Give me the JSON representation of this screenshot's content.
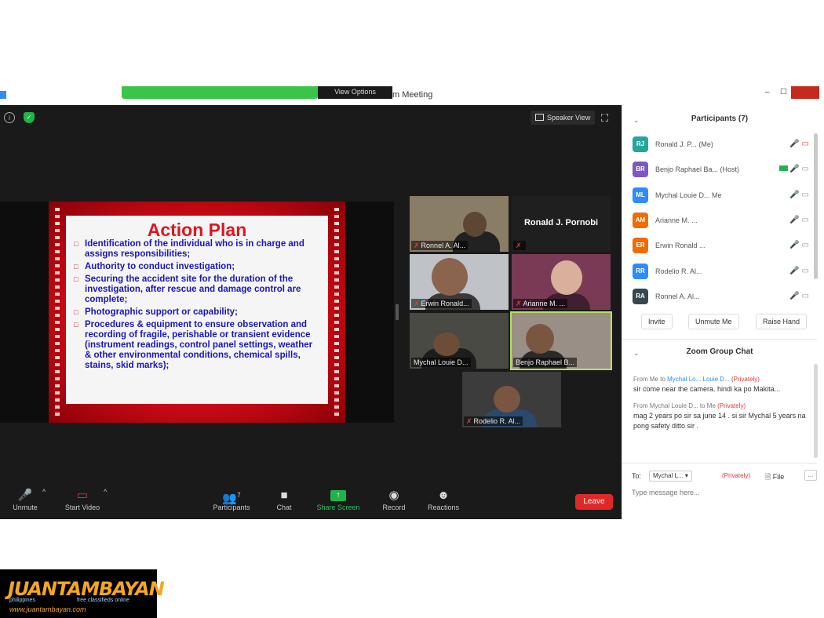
{
  "window": {
    "title_fragment": "m Meeting",
    "view_options": "View Options"
  },
  "video": {
    "speaker_view": "Speaker View",
    "slide": {
      "title": "Action Plan",
      "items": [
        "Identification of the individual who is in charge and assigns responsibilities;",
        "Authority to conduct investigation;",
        "Securing the accident site for the duration of the investigation, after rescue and damage control are complete;",
        "Photographic support or capability;",
        "Procedures & equipment to ensure observation and recording of fragile, perishable or transient evidence (instrument readings, control panel settings, weather & other environmental conditions, chemical spills, stains, skid marks);"
      ]
    },
    "tiles": [
      {
        "name": "Ronnel A. Al..."
      },
      {
        "name": "Ronald J. Pornobi"
      },
      {
        "name": "Erwin Ronald..."
      },
      {
        "name": "Arianne M. ..."
      },
      {
        "name": "Mychal Louie D..."
      },
      {
        "name": "Benjo Raphael B..."
      },
      {
        "name": "Rodelio R. Al..."
      }
    ]
  },
  "toolbar": {
    "unmute": "Unmute",
    "start_video": "Start Video",
    "participants": "Participants",
    "participants_count": "7",
    "chat": "Chat",
    "share_screen": "Share Screen",
    "record": "Record",
    "reactions": "Reactions",
    "leave": "Leave"
  },
  "participants_panel": {
    "title": "Participants (7)",
    "list": [
      {
        "initials": "RJ",
        "name": "Ronald J. P... (Me)",
        "color": "#26a69a"
      },
      {
        "initials": "BR",
        "name": "Benjo Raphael Ba... (Host)",
        "color": "#7e57c2"
      },
      {
        "initials": "ML",
        "name": "Mychal Louie D... Me",
        "color": "#2d8cff"
      },
      {
        "initials": "AM",
        "name": "Arianne M. ...",
        "color": "#ef6c00"
      },
      {
        "initials": "ER",
        "name": "Erwin Ronald ...",
        "color": "#ef6c00"
      },
      {
        "initials": "RR",
        "name": "Rodelio R. Al...",
        "color": "#2d8cff"
      },
      {
        "initials": "RA",
        "name": "Ronnel A. Al...",
        "color": "#37474f"
      }
    ],
    "invite": "Invite",
    "unmute_me": "Unmute Me",
    "raise_hand": "Raise Hand"
  },
  "chat_panel": {
    "title": "Zoom Group Chat",
    "messages": [
      {
        "meta_from": "From Me to",
        "meta_to": "Mychal Lo... Louie D...",
        "meta_priv": "(Privately)",
        "text": "sir come near the camera. hindi ka po Makita..."
      },
      {
        "meta_from": "From Mychal Louie D... to Me",
        "meta_to": "",
        "meta_priv": "(Privately)",
        "text": "mag 2 years po sir sa june 14 . si sir Mychal 5 years na pong safety ditto sir ."
      }
    ],
    "to_label": "To:",
    "to_value": "Mychal L...",
    "to_priv": "(Privately)",
    "file": "File",
    "more": "...",
    "placeholder": "Type message here..."
  },
  "watermark": {
    "brand": "JUANTAMBAYAN",
    "tag1": "philippines",
    "tag2": "free classifieds online",
    "url": "www.juantambayan.com"
  }
}
